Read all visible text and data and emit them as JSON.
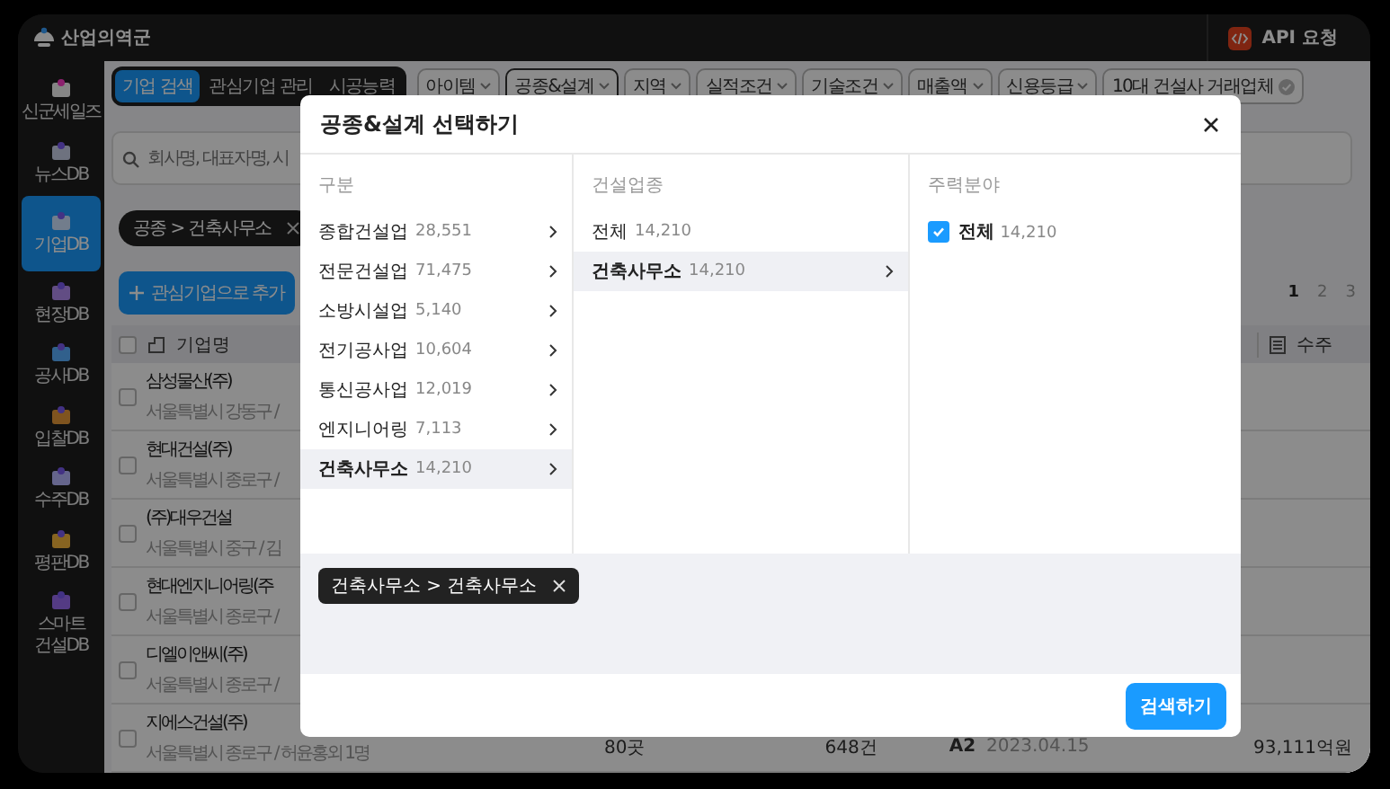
{
  "app": {
    "logo": "산업의역군",
    "api_button": "API 요청"
  },
  "sidebar": {
    "items": [
      {
        "label": "신군세일즈",
        "selected": false
      },
      {
        "label": "뉴스DB",
        "selected": false
      },
      {
        "label": "기업DB",
        "selected": true
      },
      {
        "label": "현장DB",
        "selected": false
      },
      {
        "label": "공사DB",
        "selected": false
      },
      {
        "label": "입찰DB",
        "selected": false
      },
      {
        "label": "수주DB",
        "selected": false
      },
      {
        "label": "평판DB",
        "selected": false
      },
      {
        "label": "스마트 건설DB",
        "selected": false
      }
    ]
  },
  "tabs": [
    {
      "label": "기업 검색",
      "selected": true
    },
    {
      "label": "관심기업 관리",
      "selected": false
    },
    {
      "label": "시공능력",
      "selected": false
    }
  ],
  "filters": [
    {
      "label": "아이템",
      "active": false
    },
    {
      "label": "공종&설계",
      "active": true
    },
    {
      "label": "지역",
      "active": false
    },
    {
      "label": "실적조건",
      "active": false
    },
    {
      "label": "기술조건",
      "active": false
    },
    {
      "label": "매출액",
      "active": false
    },
    {
      "label": "신용등급",
      "active": false
    },
    {
      "label": "10대 건설사 거래업체",
      "active": false
    }
  ],
  "search": {
    "placeholder": "회사명, 대표자명, 시"
  },
  "applied_filter": "공종 > 건축사무소",
  "add_button": "관심기업으로 추가",
  "pagination": [
    {
      "label": "1",
      "selected": true
    },
    {
      "label": "2",
      "selected": false
    },
    {
      "label": "3",
      "selected": false
    }
  ],
  "table": {
    "columns": [
      "기업명",
      "수주"
    ],
    "all_checked": false,
    "rows": [
      {
        "name": "삼성물산(주)",
        "sub": "서울특별시 강동구 /",
        "checked": false
      },
      {
        "name": "현대건설(주)",
        "sub": "서울특별시 종로구 /",
        "checked": false
      },
      {
        "name": "(주)대우건설",
        "sub": "서울특별시 중구 / 김",
        "checked": false
      },
      {
        "name": "현대엔지니어링(주",
        "sub": "서울특별시 종로구 /",
        "checked": false
      },
      {
        "name": "디엘이앤씨(주)",
        "sub": "서울특별시 종로구 /",
        "checked": false
      },
      {
        "name": "지에스건설(주)",
        "sub": "서울특별시 종로구 / 허윤홍외 1명",
        "checked": false,
        "cells": [
          "80곳",
          "648건",
          "A2",
          "2023.04.15",
          "93,111억원"
        ]
      }
    ]
  },
  "modal": {
    "title": "공종&설계 선택하기",
    "columns": [
      {
        "heading": "구분",
        "items": [
          {
            "label": "종합건설업",
            "count": "28,551",
            "selected": false,
            "expandable": true
          },
          {
            "label": "전문건설업",
            "count": "71,475",
            "selected": false,
            "expandable": true
          },
          {
            "label": "소방시설업",
            "count": "5,140",
            "selected": false,
            "expandable": true
          },
          {
            "label": "전기공사업",
            "count": "10,604",
            "selected": false,
            "expandable": true
          },
          {
            "label": "통신공사업",
            "count": "12,019",
            "selected": false,
            "expandable": true
          },
          {
            "label": "엔지니어링",
            "count": "7,113",
            "selected": false,
            "expandable": true
          },
          {
            "label": "건축사무소",
            "count": "14,210",
            "selected": true,
            "expandable": true
          }
        ]
      },
      {
        "heading": "건설업종",
        "items": [
          {
            "label": "전체",
            "count": "14,210",
            "selected": false,
            "expandable": false
          },
          {
            "label": "건축사무소",
            "count": "14,210",
            "selected": true,
            "expandable": true
          }
        ]
      }
    ],
    "options": {
      "heading": "주력분야",
      "items": [
        {
          "label": "전체",
          "count": "14,210",
          "checked": true
        }
      ]
    },
    "chips": [
      "건축사무소 > 건축사무소"
    ],
    "submit": "검색하기"
  }
}
